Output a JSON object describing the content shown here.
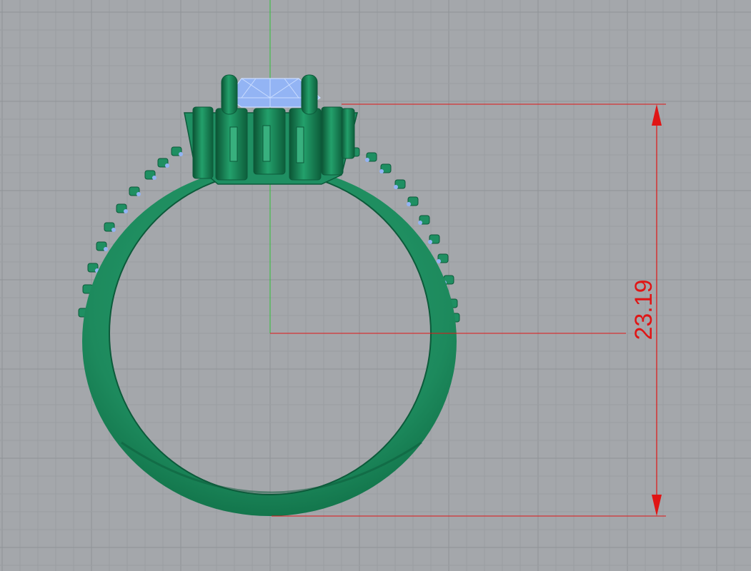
{
  "viewport": {
    "view": "Front",
    "background_color": "#a4a7ab",
    "grid": true,
    "grid_minor_color": "#9a9ea2",
    "grid_major_color": "#8f9397",
    "axis_color": "#2fc13a"
  },
  "model": {
    "metal_color": "#1f8f62",
    "metal_shadow_color": "#0c5a3a",
    "metal_highlight_color": "#38b07e",
    "gem_color": "#93b4f4",
    "gem_edge_color": "#c9dcff"
  },
  "dimension": {
    "value": "23.19",
    "color": "#e01515"
  }
}
